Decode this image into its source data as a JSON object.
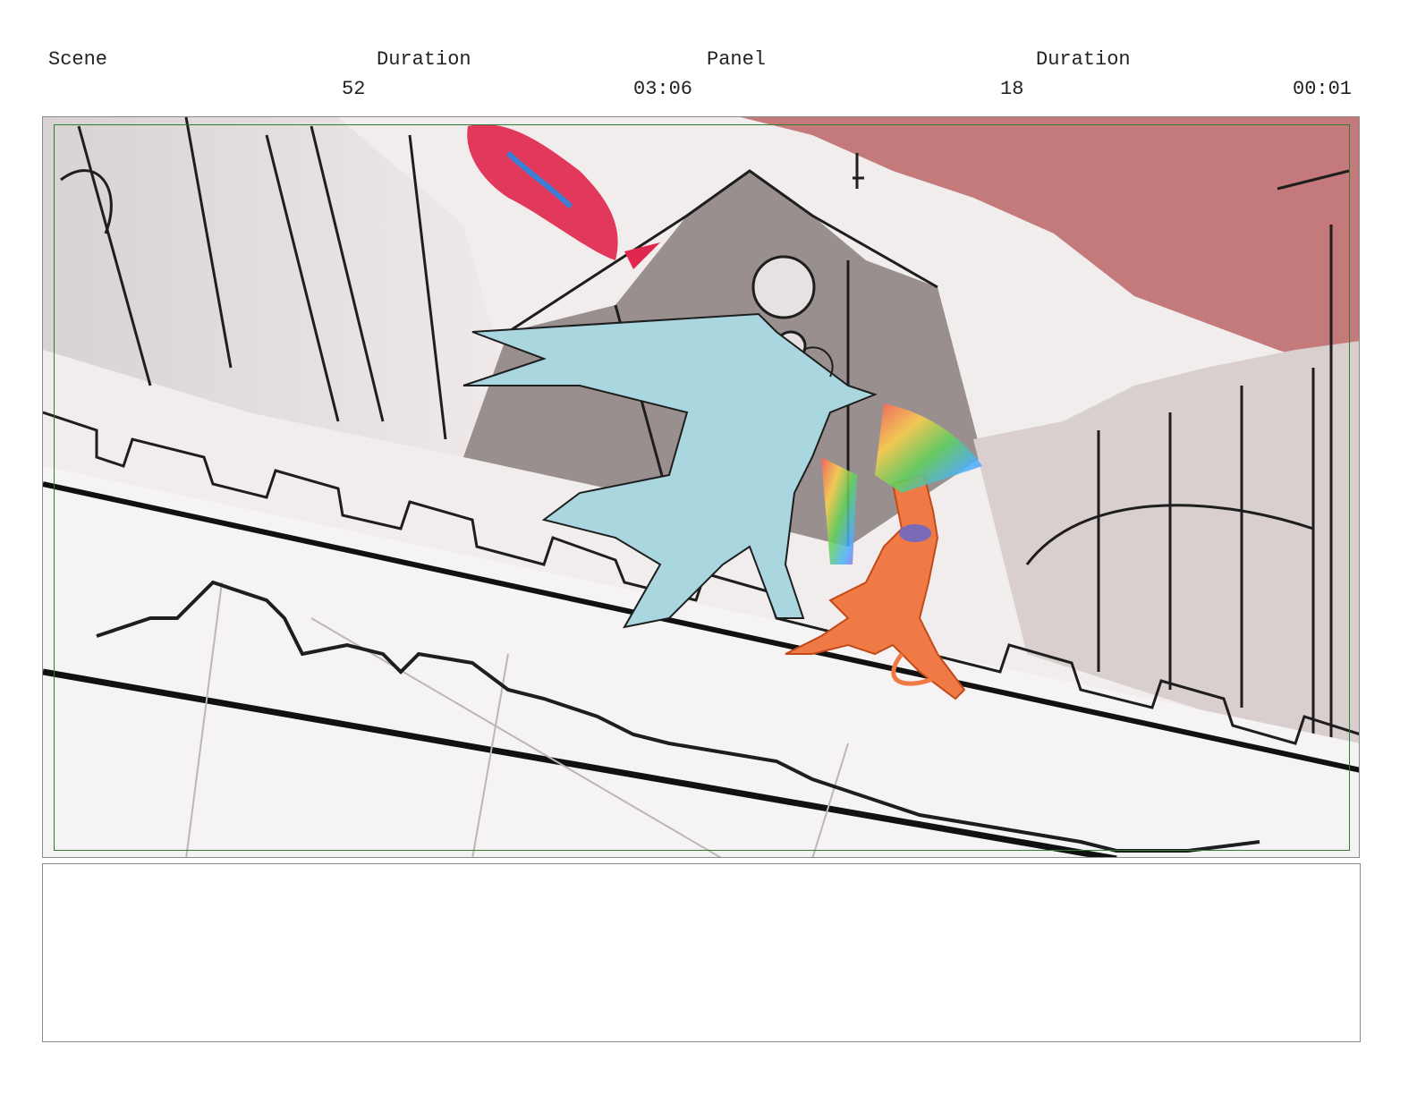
{
  "header": {
    "scene_label": "Scene",
    "scene_duration_label": "Duration",
    "panel_label": "Panel",
    "panel_duration_label": "Duration",
    "scene_value": "52",
    "scene_duration_value": "03:06",
    "panel_value": "18",
    "panel_duration_value": "00:01"
  },
  "notes": {
    "text": ""
  },
  "colors": {
    "safe_frame": "#2f7d2f",
    "sky": "#c47a7a",
    "blue_character": "#a9d6df",
    "orange_character": "#f07a45"
  }
}
